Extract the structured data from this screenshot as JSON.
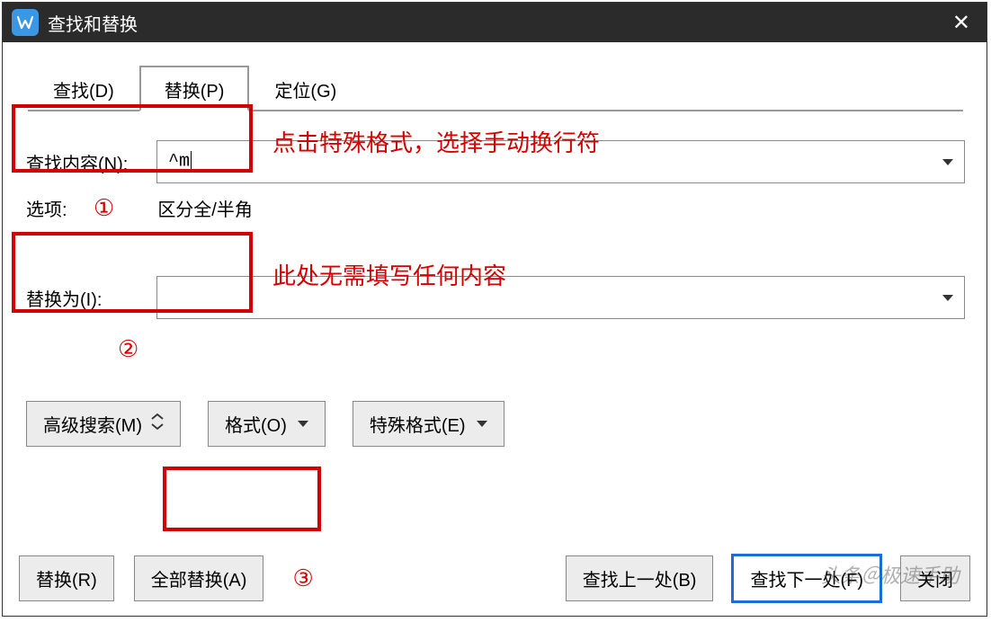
{
  "window": {
    "title": "查找和替换"
  },
  "tabs": {
    "find": "查找(D)",
    "replace": "替换(P)",
    "goto": "定位(G)"
  },
  "form": {
    "find_label": "查找内容(N):",
    "find_value": "^m",
    "options_label": "选项:",
    "options_value": "区分全/半角",
    "replace_label": "替换为(I):",
    "replace_value": ""
  },
  "annotations": {
    "note1": "点击特殊格式，选择手动换行符",
    "note2": "此处无需填写任何内容",
    "circ1": "①",
    "circ2": "②",
    "circ3": "③"
  },
  "buttons": {
    "adv_search": "高级搜索(M)",
    "format": "格式(O)",
    "special": "特殊格式(E)",
    "replace": "替换(R)",
    "replace_all": "全部替换(A)",
    "find_prev": "查找上一处(B)",
    "find_next": "查找下一处(F)",
    "close": "关闭"
  },
  "watermark": "头条＠极速手助"
}
